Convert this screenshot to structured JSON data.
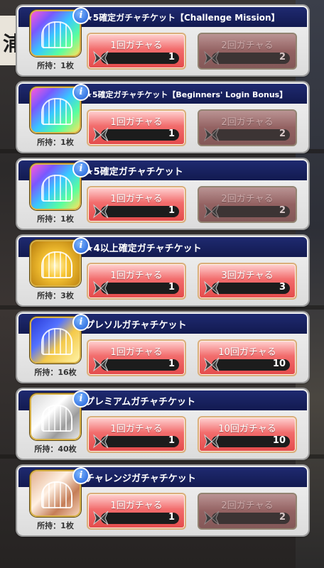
{
  "background_sign_text": "浦",
  "tickets": [
    {
      "title": "★5確定ガチャチケット【Challenge Mission】",
      "owned": "所持：1枚",
      "icon": "rainbow-ticket-icon",
      "single": {
        "label": "1回ガチャる",
        "count": "1",
        "enabled": true
      },
      "multi": {
        "label": "2回ガチャる",
        "count": "2",
        "enabled": false
      }
    },
    {
      "title": "★5確定ガチャチケット【Beginners' Login Bonus】",
      "owned": "所持：1枚",
      "icon": "rainbow-ticket-icon",
      "single": {
        "label": "1回ガチャる",
        "count": "1",
        "enabled": true
      },
      "multi": {
        "label": "2回ガチャる",
        "count": "2",
        "enabled": false
      }
    },
    {
      "title": "★5確定ガチャチケット",
      "owned": "所持：1枚",
      "icon": "rainbow-ticket-icon",
      "single": {
        "label": "1回ガチャる",
        "count": "1",
        "enabled": true
      },
      "multi": {
        "label": "2回ガチャる",
        "count": "2",
        "enabled": false
      }
    },
    {
      "title": "★4以上確定ガチャチケット",
      "owned": "所持：3枚",
      "icon": "gold-ticket-icon",
      "single": {
        "label": "1回ガチャる",
        "count": "1",
        "enabled": true
      },
      "multi": {
        "label": "3回ガチャる",
        "count": "3",
        "enabled": true
      }
    },
    {
      "title": "プレソルガチャチケット",
      "owned": "所持：16枚",
      "icon": "presol-ticket-icon",
      "single": {
        "label": "1回ガチャる",
        "count": "1",
        "enabled": true
      },
      "multi": {
        "label": "10回ガチャる",
        "count": "10",
        "enabled": true
      }
    },
    {
      "title": "プレミアムガチャチケット",
      "owned": "所持：40枚",
      "icon": "silver-ticket-icon",
      "single": {
        "label": "1回ガチャる",
        "count": "1",
        "enabled": true
      },
      "multi": {
        "label": "10回ガチャる",
        "count": "10",
        "enabled": true
      }
    },
    {
      "title": "チャレンジガチャチケット",
      "owned": "所持：1枚",
      "icon": "bronze-ticket-icon",
      "single": {
        "label": "1回ガチャる",
        "count": "1",
        "enabled": true
      },
      "multi": {
        "label": "2回ガチャる",
        "count": "2",
        "enabled": false
      }
    }
  ]
}
